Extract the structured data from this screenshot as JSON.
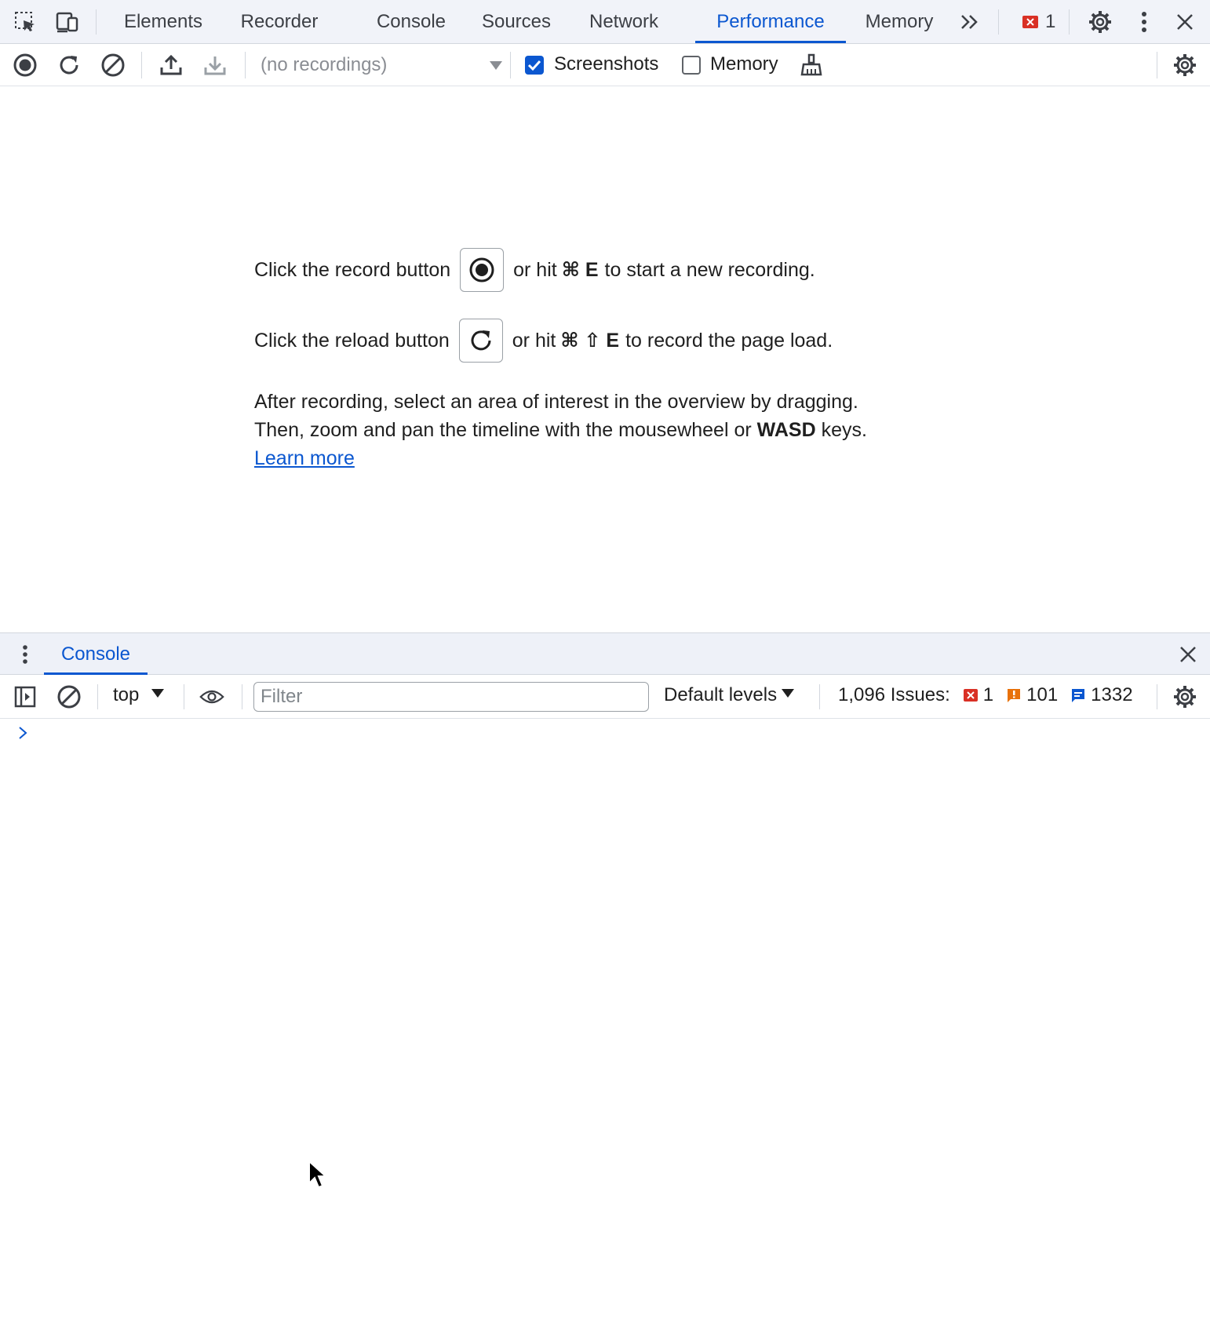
{
  "tabs": {
    "items": [
      {
        "label": "Elements"
      },
      {
        "label": "Recorder"
      },
      {
        "label": "Console"
      },
      {
        "label": "Sources"
      },
      {
        "label": "Network"
      },
      {
        "label": "Performance"
      },
      {
        "label": "Memory"
      }
    ],
    "active": "Performance",
    "error_count": "1"
  },
  "toolbar": {
    "recordings_placeholder": "(no recordings)",
    "screenshots_label": "Screenshots",
    "screenshots_checked": true,
    "memory_label": "Memory",
    "memory_checked": false
  },
  "landing": {
    "record_line": {
      "before": "Click the record button",
      "after_pre": "or hit",
      "key": "⌘ E",
      "after_post": "to start a new recording."
    },
    "reload_line": {
      "before": "Click the reload button",
      "after_pre": "or hit",
      "key": "⌘ ⇧ E",
      "after_post": "to record the page load."
    },
    "para1": "After recording, select an area of interest in the overview by dragging.",
    "para2_before": "Then, zoom and pan the timeline with the mousewheel or",
    "para2_key": "WASD",
    "para2_after": "keys.",
    "learn_more": "Learn more"
  },
  "drawer": {
    "tab_label": "Console"
  },
  "console_toolbar": {
    "context": "top",
    "filter_placeholder": "Filter",
    "levels": "Default levels",
    "issues_label": "1,096 Issues:",
    "errors": "1",
    "warnings": "101",
    "info": "1332"
  },
  "colors": {
    "accent": "#0b57d0",
    "error": "#d93025",
    "warning": "#e8710a"
  }
}
